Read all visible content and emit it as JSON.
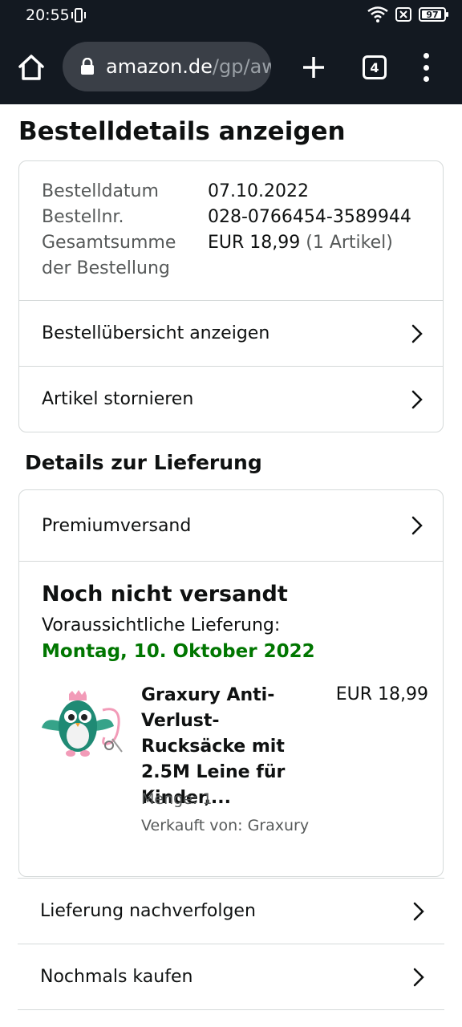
{
  "status_bar": {
    "time": "20:55",
    "battery_level": "97"
  },
  "browser": {
    "url_host": "amazon.de",
    "url_path": "/gp/aw",
    "tab_count": "4"
  },
  "page": {
    "title": "Bestelldetails anzeigen",
    "order_info": {
      "date_label": "Bestelldatum",
      "date_value": "07.10.2022",
      "number_label": "Bestellnr.",
      "number_value": "028-0766454-3589944",
      "total_label_line1": "Gesamtsumme",
      "total_label_line2": "der Bestellung",
      "total_value": "EUR 18,99",
      "total_items": "(1 Artikel)"
    },
    "links": {
      "overview": "Bestellübersicht anzeigen",
      "cancel": "Artikel stornieren"
    },
    "delivery": {
      "section_title": "Details zur Lieferung",
      "shipping_method": "Premiumversand",
      "status": "Noch nicht versandt",
      "expected_label": "Voraussichtliche Lieferung:",
      "expected_date": "Montag, 10. Oktober 2022",
      "date_color": "#007600"
    },
    "product": {
      "title": "Graxury Anti-Verlust-Rucksäcke mit 2.5M Leine für Kinder,...",
      "price": "EUR 18,99",
      "quantity": "Menge: 1",
      "seller": "Verkauft von: Graxury"
    },
    "bottom_links": {
      "track": "Lieferung nachverfolgen",
      "buy_again": "Nochmals kaufen"
    }
  }
}
